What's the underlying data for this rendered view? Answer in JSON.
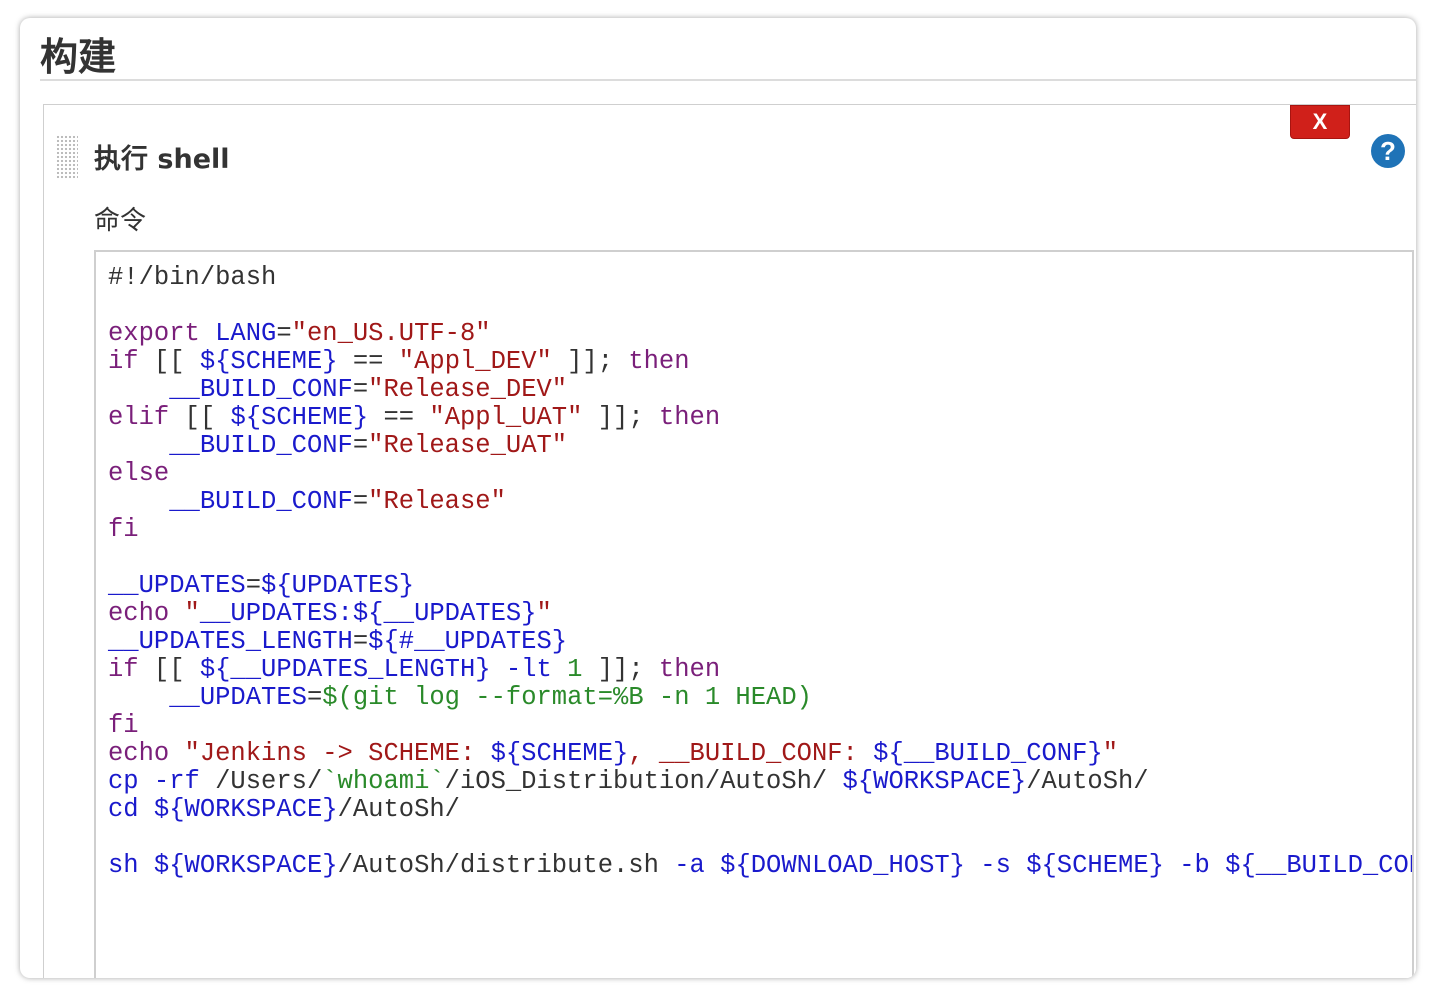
{
  "section": {
    "title": "构建"
  },
  "step": {
    "title": "执行 shell",
    "delete_label": "X",
    "help_label": "?",
    "field_label": "命令"
  },
  "code_lines": [
    [
      {
        "t": "#!/bin/bash",
        "c": ""
      }
    ],
    [
      {
        "t": "",
        "c": ""
      }
    ],
    [
      {
        "t": "export ",
        "c": "kw"
      },
      {
        "t": "LANG",
        "c": "var"
      },
      {
        "t": "=",
        "c": ""
      },
      {
        "t": "\"en_US.UTF-8\"",
        "c": "str"
      }
    ],
    [
      {
        "t": "if",
        "c": "kw"
      },
      {
        "t": " [[ ",
        "c": ""
      },
      {
        "t": "${SCHEME}",
        "c": "var"
      },
      {
        "t": " == ",
        "c": ""
      },
      {
        "t": "\"Appl_DEV\"",
        "c": "str"
      },
      {
        "t": " ]]; ",
        "c": ""
      },
      {
        "t": "then",
        "c": "kw"
      }
    ],
    [
      {
        "t": "    ",
        "c": ""
      },
      {
        "t": "__BUILD_CONF",
        "c": "var"
      },
      {
        "t": "=",
        "c": ""
      },
      {
        "t": "\"Release_DEV\"",
        "c": "str"
      }
    ],
    [
      {
        "t": "elif",
        "c": "kw"
      },
      {
        "t": " [[ ",
        "c": ""
      },
      {
        "t": "${SCHEME}",
        "c": "var"
      },
      {
        "t": " == ",
        "c": ""
      },
      {
        "t": "\"Appl_UAT\"",
        "c": "str"
      },
      {
        "t": " ]]; ",
        "c": ""
      },
      {
        "t": "then",
        "c": "kw"
      }
    ],
    [
      {
        "t": "    ",
        "c": ""
      },
      {
        "t": "__BUILD_CONF",
        "c": "var"
      },
      {
        "t": "=",
        "c": ""
      },
      {
        "t": "\"Release_UAT\"",
        "c": "str"
      }
    ],
    [
      {
        "t": "else",
        "c": "kw"
      }
    ],
    [
      {
        "t": "    ",
        "c": ""
      },
      {
        "t": "__BUILD_CONF",
        "c": "var"
      },
      {
        "t": "=",
        "c": ""
      },
      {
        "t": "\"Release\"",
        "c": "str"
      }
    ],
    [
      {
        "t": "fi",
        "c": "kw"
      }
    ],
    [
      {
        "t": "",
        "c": ""
      }
    ],
    [
      {
        "t": "__UPDATES",
        "c": "var"
      },
      {
        "t": "=",
        "c": ""
      },
      {
        "t": "${UPDATES}",
        "c": "var"
      }
    ],
    [
      {
        "t": "echo",
        "c": "kw"
      },
      {
        "t": " \"",
        "c": "dq"
      },
      {
        "t": "__UPDATES:${__UPDATES}",
        "c": "var"
      },
      {
        "t": "\"",
        "c": "dq"
      }
    ],
    [
      {
        "t": "__UPDATES_LENGTH",
        "c": "var"
      },
      {
        "t": "=",
        "c": ""
      },
      {
        "t": "${#__UPDATES}",
        "c": "var"
      }
    ],
    [
      {
        "t": "if",
        "c": "kw"
      },
      {
        "t": " [[ ",
        "c": ""
      },
      {
        "t": "${__UPDATES_LENGTH}",
        "c": "var"
      },
      {
        "t": " -lt ",
        "c": "var"
      },
      {
        "t": "1",
        "c": "cmd"
      },
      {
        "t": " ]]; ",
        "c": ""
      },
      {
        "t": "then",
        "c": "kw"
      }
    ],
    [
      {
        "t": "    ",
        "c": ""
      },
      {
        "t": "__UPDATES",
        "c": "var"
      },
      {
        "t": "=",
        "c": ""
      },
      {
        "t": "$(git log --format=%B -n 1 HEAD)",
        "c": "cmd"
      }
    ],
    [
      {
        "t": "fi",
        "c": "kw"
      }
    ],
    [
      {
        "t": "echo",
        "c": "kw"
      },
      {
        "t": " \"Jenkins -> SCHEME: ",
        "c": "str"
      },
      {
        "t": "${SCHEME}",
        "c": "var"
      },
      {
        "t": ", ",
        "c": "str"
      },
      {
        "t": "__BUILD_CONF: ",
        "c": "str"
      },
      {
        "t": "${__BUILD_CONF}",
        "c": "var"
      },
      {
        "t": "\"",
        "c": "str"
      }
    ],
    [
      {
        "t": "cp -rf ",
        "c": "var"
      },
      {
        "t": "/Users/",
        "c": ""
      },
      {
        "t": "`whoami`",
        "c": "cmd"
      },
      {
        "t": "/iOS_Distribution/AutoSh/ ",
        "c": ""
      },
      {
        "t": "${WORKSPACE}",
        "c": "var"
      },
      {
        "t": "/AutoSh/",
        "c": ""
      }
    ],
    [
      {
        "t": "cd ",
        "c": "var"
      },
      {
        "t": "${WORKSPACE}",
        "c": "var"
      },
      {
        "t": "/AutoSh/",
        "c": ""
      }
    ],
    [
      {
        "t": "",
        "c": ""
      }
    ],
    [
      {
        "t": "sh ",
        "c": "var"
      },
      {
        "t": "${WORKSPACE}",
        "c": "var"
      },
      {
        "t": "/AutoSh/distribute.sh ",
        "c": ""
      },
      {
        "t": "-a ",
        "c": "var"
      },
      {
        "t": "${DOWNLOAD_HOST}",
        "c": "var"
      },
      {
        "t": " -s ",
        "c": "var"
      },
      {
        "t": "${SCHEME}",
        "c": "var"
      },
      {
        "t": " -b ",
        "c": "var"
      },
      {
        "t": "${__BUILD_CONF}",
        "c": "var"
      }
    ]
  ]
}
